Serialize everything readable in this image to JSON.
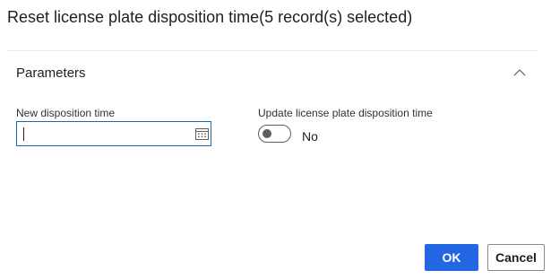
{
  "dialog": {
    "title": "Reset license plate disposition time(5 record(s) selected)"
  },
  "section": {
    "title": "Parameters",
    "icon": "chevron-up-icon",
    "expanded": true
  },
  "fields": {
    "new_disposition_time": {
      "label": "New disposition time",
      "value": "",
      "icon": "calendar-icon"
    },
    "update_disposition_time": {
      "label": "Update license plate disposition time",
      "state_text": "No",
      "checked": false
    }
  },
  "buttons": {
    "ok_label": "OK",
    "cancel_label": "Cancel"
  },
  "colors": {
    "accent": "#2266e3",
    "focus_border": "#0f6cbd",
    "text": "#201f1e",
    "toggle_off": "#605e5c"
  }
}
